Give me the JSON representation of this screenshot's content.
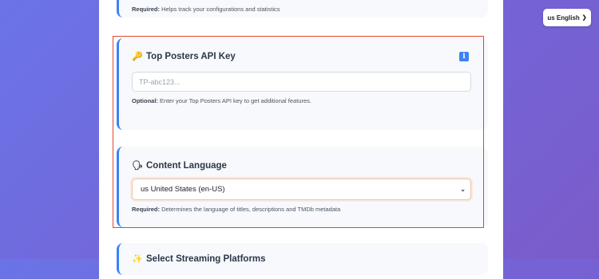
{
  "language_selector": {
    "label": "us English",
    "chevron_icon": "chevron-down-icon"
  },
  "top_section": {
    "help_prefix": "Required:",
    "help_text": "Helps track your configurations and statistics"
  },
  "api_key_section": {
    "icon": "key-icon",
    "icon_glyph": "🔑",
    "title": "Top Posters API Key",
    "info_icon": "info-icon",
    "info_glyph": "i",
    "input": {
      "value": "",
      "placeholder": "TP-abc123..."
    },
    "help_prefix": "Optional:",
    "help_text": "Enter your Top Posters API key to get additional features."
  },
  "content_language_section": {
    "icon": "speaking-head-icon",
    "icon_glyph": "🗣",
    "title": "Content Language",
    "select": {
      "selected": "us United States (en-US)"
    },
    "help_prefix": "Required:",
    "help_text": "Determines the language of titles, descriptions and TMDb metadata"
  },
  "streaming_section": {
    "icon": "sparkle-icon",
    "icon_glyph": "✨",
    "title": "Select Streaming Platforms"
  },
  "colors": {
    "accent": "#3b82f6",
    "highlight_border": "#e5442d",
    "background_start": "#6a74e6",
    "background_end": "#7a5cc9"
  }
}
